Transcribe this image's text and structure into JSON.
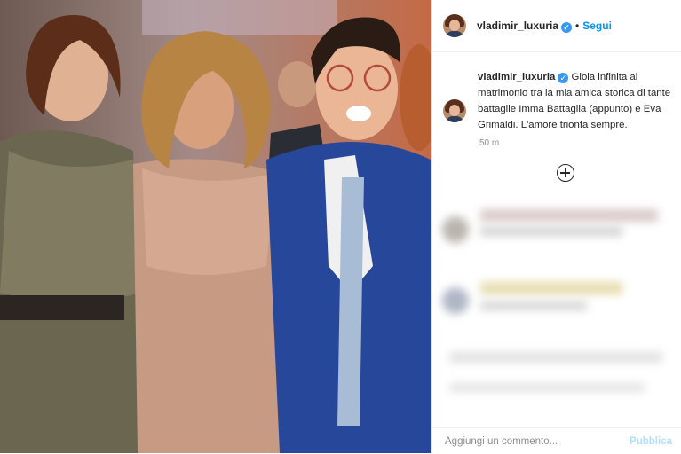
{
  "post": {
    "username": "vladimir_luxuria",
    "verified_mark": "✓",
    "separator": "•",
    "follow_label": "Segui",
    "caption_user": "vladimir_luxuria",
    "caption_text": "Gioia infinita al matrimonio tra la mia amica storica di tante battaglie Imma Battaglia (appunto) e Eva Grimaldi. L'amore trionfa sempre.",
    "time": "50 m",
    "comment_placeholder": "Aggiungi un commento...",
    "publish_label": "Pubblica"
  },
  "icons": {
    "load_more": "plus-circle-icon",
    "verified": "verified-badge-icon"
  },
  "colors": {
    "accent": "#0095f6",
    "verified": "#3897f0",
    "publish_disabled": "#b2dffc",
    "suit": "#27479a"
  }
}
